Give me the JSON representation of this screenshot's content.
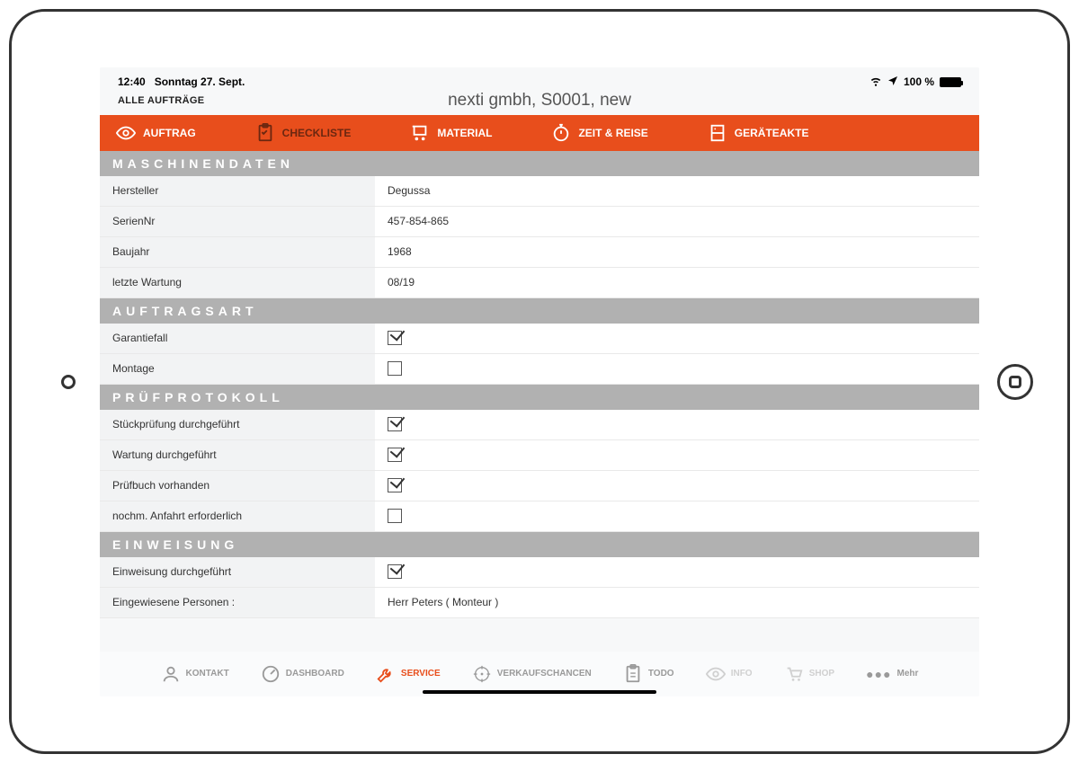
{
  "status": {
    "time": "12:40",
    "date": "Sonntag 27. Sept.",
    "battery": "100 %"
  },
  "header": {
    "all_orders": "ALLE AUFTRÄGE",
    "title": "nexti gmbh, S0001, new"
  },
  "tabs": {
    "auftrag": "AUFTRAG",
    "checkliste": "CHECKLISTE",
    "material": "MATERIAL",
    "zeit": "ZEIT & REISE",
    "geraeteakte": "GERÄTEAKTE"
  },
  "sections": {
    "maschinendaten": {
      "title": "MASCHINENDATEN",
      "rows": [
        {
          "label": "Hersteller",
          "value": "Degussa"
        },
        {
          "label": "SerienNr",
          "value": "457-854-865"
        },
        {
          "label": "Baujahr",
          "value": "1968"
        },
        {
          "label": "letzte Wartung",
          "value": "08/19"
        }
      ]
    },
    "auftragsart": {
      "title": "AUFTRAGSART",
      "rows": [
        {
          "label": "Garantiefall",
          "checked": true
        },
        {
          "label": "Montage",
          "checked": false
        }
      ]
    },
    "pruefprotokoll": {
      "title": "PRÜFPROTOKOLL",
      "rows": [
        {
          "label": "Stückprüfung durchgeführt",
          "checked": true
        },
        {
          "label": "Wartung durchgeführt",
          "checked": true
        },
        {
          "label": "Prüfbuch vorhanden",
          "checked": true
        },
        {
          "label": "nochm. Anfahrt erforderlich",
          "checked": false
        }
      ]
    },
    "einweisung": {
      "title": "EINWEISUNG",
      "rows": [
        {
          "label": "Einweisung durchgeführt",
          "checked": true
        },
        {
          "label": "Eingewiesene Personen :",
          "value": "Herr Peters ( Monteur )"
        }
      ]
    }
  },
  "bottom_nav": {
    "kontakt": "KONTAKT",
    "dashboard": "DASHBOARD",
    "service": "SERVICE",
    "verkaufschancen": "VERKAUFSCHANCEN",
    "todo": "TODO",
    "info": "INFO",
    "shop": "SHOP",
    "mehr": "Mehr"
  }
}
